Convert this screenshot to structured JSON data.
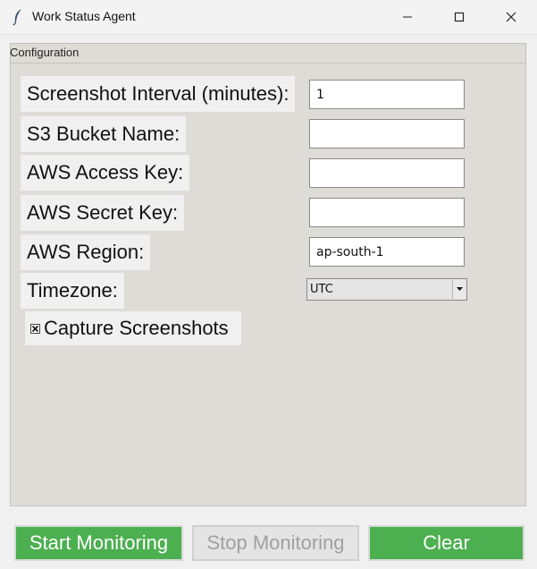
{
  "window": {
    "title": "Work Status Agent",
    "icon": "feather-icon"
  },
  "frame": {
    "label": "Configuration"
  },
  "fields": {
    "interval_label": "Screenshot Interval (minutes):",
    "interval_value": "1",
    "bucket_label": "S3 Bucket Name:",
    "bucket_value": "",
    "access_label": "AWS Access Key:",
    "access_value": "",
    "secret_label": "AWS Secret Key:",
    "secret_value": "",
    "region_label": "AWS Region:",
    "region_value": "ap-south-1",
    "timezone_label": "Timezone:",
    "timezone_value": "UTC"
  },
  "capture": {
    "label": "Capture Screenshots",
    "checked": true
  },
  "buttons": {
    "start": "Start Monitoring",
    "stop": "Stop Monitoring",
    "clear": "Clear"
  },
  "colors": {
    "accent_green": "#4caf50",
    "disabled_text": "#a0a0a0"
  }
}
